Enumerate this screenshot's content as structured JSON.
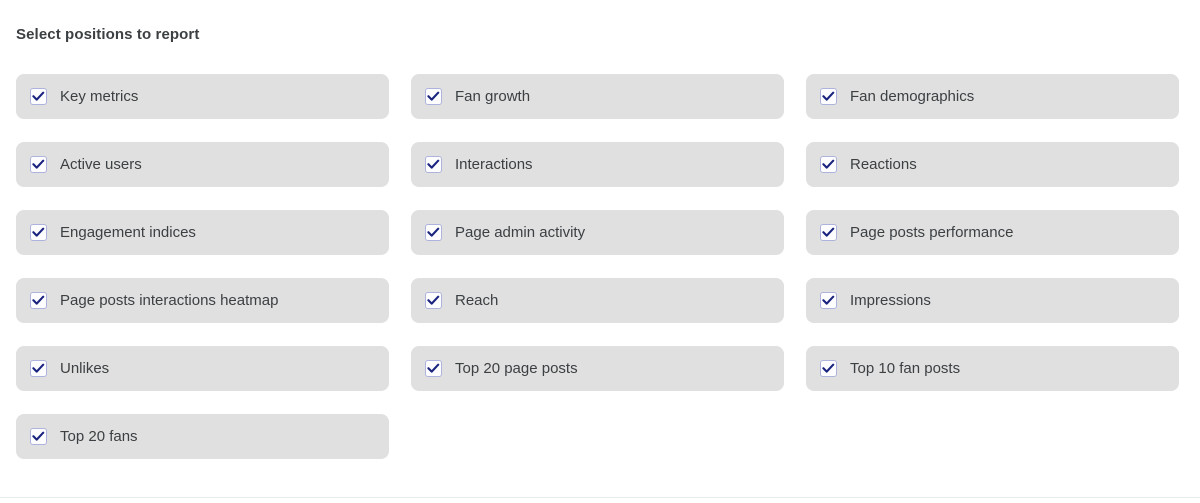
{
  "section": {
    "title": "Select positions to report"
  },
  "colors": {
    "pill_background": "#e0e0e0",
    "label_text": "#3c4043",
    "checkbox_border": "#aeb3dd",
    "checkbox_fill": "#fdfdff",
    "checkmark": "#1a237e",
    "divider": "#e8eaed",
    "page_background": "#ffffff"
  },
  "options": [
    {
      "label": "Key metrics",
      "checked": true,
      "icon": "checkmark-icon"
    },
    {
      "label": "Fan growth",
      "checked": true,
      "icon": "checkmark-icon"
    },
    {
      "label": "Fan demographics",
      "checked": true,
      "icon": "checkmark-icon"
    },
    {
      "label": "Active users",
      "checked": true,
      "icon": "checkmark-icon"
    },
    {
      "label": "Interactions",
      "checked": true,
      "icon": "checkmark-icon"
    },
    {
      "label": "Reactions",
      "checked": true,
      "icon": "checkmark-icon"
    },
    {
      "label": "Engagement indices",
      "checked": true,
      "icon": "checkmark-icon"
    },
    {
      "label": "Page admin activity",
      "checked": true,
      "icon": "checkmark-icon"
    },
    {
      "label": "Page posts performance",
      "checked": true,
      "icon": "checkmark-icon"
    },
    {
      "label": "Page posts interactions heatmap",
      "checked": true,
      "icon": "checkmark-icon"
    },
    {
      "label": "Reach",
      "checked": true,
      "icon": "checkmark-icon"
    },
    {
      "label": "Impressions",
      "checked": true,
      "icon": "checkmark-icon"
    },
    {
      "label": "Unlikes",
      "checked": true,
      "icon": "checkmark-icon"
    },
    {
      "label": "Top 20 page posts",
      "checked": true,
      "icon": "checkmark-icon"
    },
    {
      "label": "Top 10 fan posts",
      "checked": true,
      "icon": "checkmark-icon"
    },
    {
      "label": "Top 20 fans",
      "checked": true,
      "icon": "checkmark-icon"
    }
  ]
}
